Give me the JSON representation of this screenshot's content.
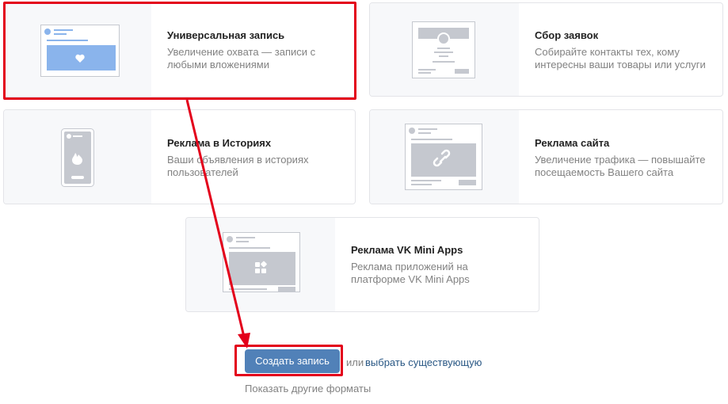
{
  "formats": [
    {
      "title": "Универсальная запись",
      "desc": "Увеличение охвата — записи с любыми вложениями",
      "icon": "heart-icon"
    },
    {
      "title": "Сбор заявок",
      "desc": "Собирайте контакты тех, кому интересны ваши товары или услуги",
      "icon": "form-icon"
    },
    {
      "title": "Реклама в Историях",
      "desc": "Ваши объявления в историях пользователей",
      "icon": "fire-icon"
    },
    {
      "title": "Реклама сайта",
      "desc": "Увеличение трафика — повышайте посещаемость Вашего сайта",
      "icon": "link-icon"
    },
    {
      "title": "Реклама VK Mini Apps",
      "desc": "Реклама приложений на платформе VK Mini Apps",
      "icon": "apps-icon"
    }
  ],
  "actions": {
    "create_button": "Создать запись",
    "or_text": "или",
    "choose_existing": "выбрать существующую",
    "show_other_formats": "Показать другие форматы"
  },
  "colors": {
    "primary_button": "#5181b8",
    "link": "#2a5885",
    "accent_blue": "#8ab4ec",
    "annotation_red": "#e3001b"
  }
}
